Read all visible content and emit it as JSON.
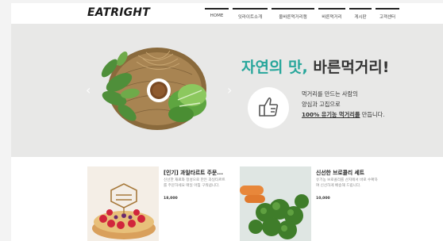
{
  "brand": {
    "logo": "EATRIGHT"
  },
  "nav": {
    "items": [
      "HOME",
      "잇라이트소개",
      "올바른먹거리캠",
      "바른먹거리",
      "게시판",
      "고객센터"
    ]
  },
  "hero": {
    "title_accent": "자연의 맛,",
    "title_rest": " 바른먹거리!",
    "line1": "먹거리를 만드는 사람의",
    "line2": "양심과 고집으로",
    "line3_underline": "100% 유기농 먹거리를",
    "line3_rest": " 만듭니다.",
    "prev_arrow": "‹",
    "next_arrow": "›",
    "icons": [
      "thumbs-up-icon",
      "vegetable-basket-image"
    ]
  },
  "products": [
    {
      "title": "[인기] 과일타르트 주문...",
      "desc": "신선한 재료와 정성으로 만든 과일타르트를 주문하세요 매일 아침 구워냅니다.",
      "price": "18,000"
    },
    {
      "title": "신선한 브로콜리 세트",
      "desc": "유기농 브로콜리를 산지에서 바로 수확하여 신선하게 배송해 드립니다.",
      "price": "10,000"
    }
  ],
  "colors": {
    "accent": "#27a69b",
    "hero_bg": "#e8e8e7",
    "nav_border": "#222222"
  }
}
